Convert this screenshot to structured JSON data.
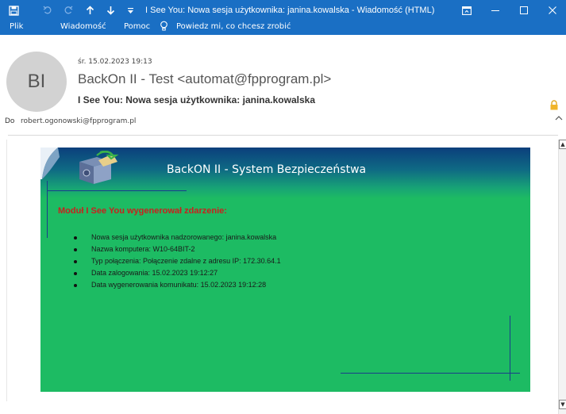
{
  "window": {
    "title": "I See You: Nowa sesja użytkownika: janina.kowalska  -  Wiadomość (HTML)",
    "save_icon": "save-icon",
    "undo_icon": "undo-icon",
    "redo_icon": "redo-icon",
    "up_icon": "arrow-up-icon",
    "down_icon": "arrow-down-icon",
    "customize_icon": "customize-toolbar-icon"
  },
  "menu": {
    "file": "Plik",
    "message": "Wiadomość",
    "help": "Pomoc",
    "tell_me": "Powiedz mi, co chcesz zrobić"
  },
  "header": {
    "avatar_initials": "BI",
    "date": "śr. 15.02.2023 19:13",
    "from": "BackOn II - Test <automat@fpprogram.pl>",
    "subject": "I See You: Nowa sesja użytkownika: janina.kowalska",
    "to_label": "Do",
    "to_value": "robert.ogonowski@fpprogram.pl"
  },
  "body": {
    "banner_title": "BackON II - System Bezpieczeństwa",
    "module_title": "Moduł I See You wygenerował zdarzenie:",
    "items": [
      "Nowa sesja użytkownika nadzorowanego: janina.kowalska",
      "Nazwa komputera: W10-64BIT-2",
      "Typ połączenia: Połączenie zdalne z adresu IP: 172.30.64.1",
      "Data zalogowania: 15.02.2023 19:12:27",
      "Data wygenerowania komunikatu: 15.02.2023 19:12:28"
    ]
  },
  "colors": {
    "titlebar": "#1a6fc4",
    "banner_green": "#1dbb63",
    "banner_blue": "#0b3f7c",
    "module_title": "#c8211e"
  }
}
